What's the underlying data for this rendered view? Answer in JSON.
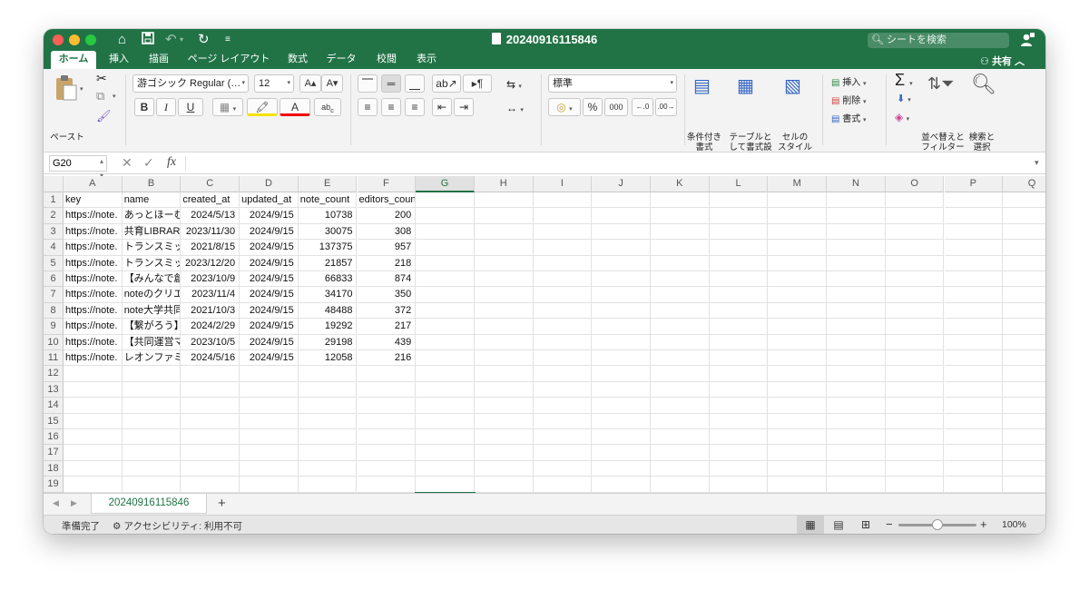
{
  "window": {
    "title": "20240916115846",
    "search_placeholder": "シートを検索"
  },
  "tabs": [
    {
      "label": "ホーム",
      "active": true
    },
    {
      "label": "挿入"
    },
    {
      "label": "描画"
    },
    {
      "label": "ページ レイアウト"
    },
    {
      "label": "数式"
    },
    {
      "label": "データ"
    },
    {
      "label": "校閲"
    },
    {
      "label": "表示"
    }
  ],
  "share_label": "共有",
  "ribbon": {
    "paste_label": "ペースト",
    "font_name": "游ゴシック Regular (…",
    "font_size": "12",
    "number_format": "標準",
    "conditional_format": [
      "条件付き",
      "書式"
    ],
    "table_format": [
      "テーブルと",
      "して書式設定"
    ],
    "cell_style": [
      "セルの",
      "スタイル"
    ],
    "insert_label": "挿入",
    "delete_label": "削除",
    "format_label": "書式",
    "sort_filter": [
      "並べ替えと",
      "フィルター"
    ],
    "find_select": [
      "検索と",
      "選択"
    ]
  },
  "formula_bar": {
    "name_box": "G20",
    "formula": ""
  },
  "sheet": {
    "columns": [
      "A",
      "B",
      "C",
      "D",
      "E",
      "F",
      "G",
      "H",
      "I",
      "J",
      "K",
      "L",
      "M",
      "N",
      "O",
      "P",
      "Q"
    ],
    "selected_column": "G",
    "selected_row": 20,
    "row_count": 21,
    "rows": [
      [
        "key",
        "name",
        "created_at",
        "updated_at",
        "note_count",
        "editors_count"
      ],
      [
        "https://note.",
        "あっとほーむ",
        "2024/5/13",
        "2024/9/15",
        "10738",
        "200"
      ],
      [
        "https://note.",
        "共育LIBRARY",
        "2023/11/30",
        "2024/9/15",
        "30075",
        "308"
      ],
      [
        "https://note.",
        "トランスミッ",
        "2021/8/15",
        "2024/9/15",
        "137375",
        "957"
      ],
      [
        "https://note.",
        "トランスミッ",
        "2023/12/20",
        "2024/9/15",
        "21857",
        "218"
      ],
      [
        "https://note.",
        "【みんなで創",
        "2023/10/9",
        "2024/9/15",
        "66833",
        "874"
      ],
      [
        "https://note.",
        "noteのクリエ",
        "2023/11/4",
        "2024/9/15",
        "34170",
        "350"
      ],
      [
        "https://note.",
        "note大学共同",
        "2021/10/3",
        "2024/9/15",
        "48488",
        "372"
      ],
      [
        "https://note.",
        "【繋がろう】",
        "2024/2/29",
        "2024/9/15",
        "19292",
        "217"
      ],
      [
        "https://note.",
        "【共同運営マ",
        "2023/10/5",
        "2024/9/15",
        "29198",
        "439"
      ],
      [
        "https://note.",
        "レオンファミ",
        "2024/5/16",
        "2024/9/15",
        "12058",
        "216"
      ]
    ]
  },
  "sheet_tabs": [
    "20240916115846"
  ],
  "status": {
    "ready": "準備完了",
    "accessibility": "アクセシビリティ: 利用不可",
    "zoom": "100%",
    "zoom_fraction": 0.5
  }
}
